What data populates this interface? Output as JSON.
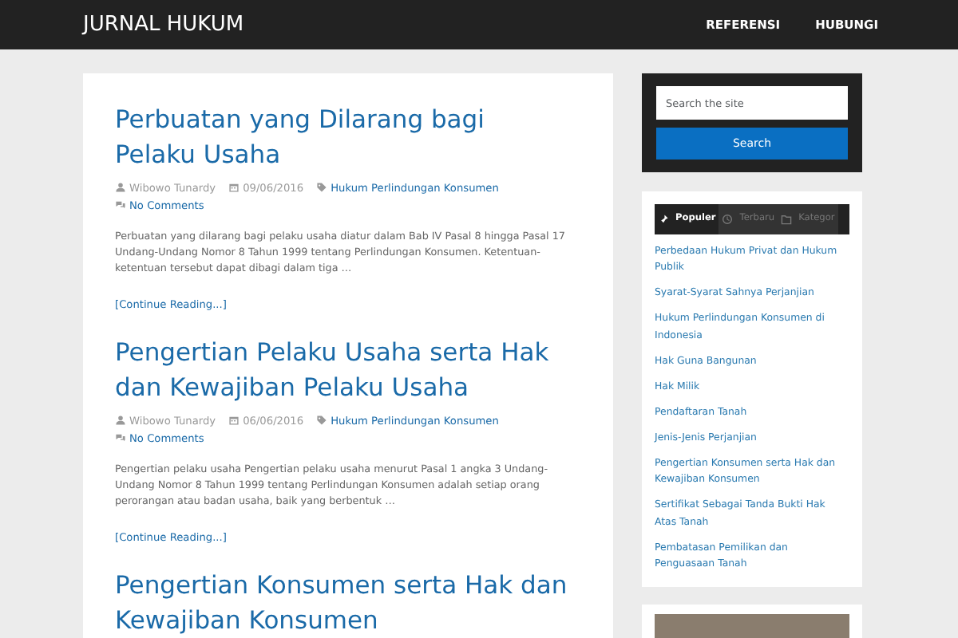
{
  "navbar": {
    "brand": "JURNAL HUKUM",
    "items": [
      "REFERENSI",
      "HUBUNGI"
    ]
  },
  "posts": [
    {
      "title": "Perbuatan yang Dilarang bagi Pelaku Usaha",
      "author": "Wibowo Tunardy",
      "date": "09/06/2016",
      "category": "Hukum Perlindungan Konsumen",
      "comments": "No Comments",
      "excerpt": "Perbuatan yang dilarang bagi pelaku usaha diatur dalam Bab IV Pasal 8 hingga Pasal 17 Undang-Undang Nomor 8 Tahun 1999 tentang Perlindungan Konsumen. Ketentuan-ketentuan tersebut dapat dibagi dalam tiga …",
      "more": "[Continue Reading...]"
    },
    {
      "title": "Pengertian Pelaku Usaha serta Hak dan Kewajiban Pelaku Usaha",
      "author": "Wibowo Tunardy",
      "date": "06/06/2016",
      "category": "Hukum Perlindungan Konsumen",
      "comments": "No Comments",
      "excerpt": "Pengertian pelaku usaha Pengertian pelaku usaha menurut Pasal 1 angka 3 Undang-Undang Nomor 8 Tahun 1999 tentang Perlindungan Konsumen adalah setiap orang perorangan atau badan usaha, baik yang berbentuk …",
      "more": "[Continue Reading...]"
    },
    {
      "title": "Pengertian Konsumen serta Hak dan Kewajiban Konsumen"
    }
  ],
  "search": {
    "placeholder": "Search the site",
    "button": "Search"
  },
  "tabs": [
    {
      "label": "Populer",
      "kind": "popular",
      "selected": true
    },
    {
      "label": "Terbaru",
      "kind": "recent",
      "selected": false
    },
    {
      "label": "Kategor",
      "kind": "category",
      "selected": false
    }
  ],
  "links": [
    "Perbedaan Hukum Privat dan Hukum Publik",
    "Syarat-Syarat Sahnya Perjanjian",
    "Hukum Perlindungan Konsumen di Indonesia",
    "Hak Guna Bangunan",
    "Hak Milik",
    "Pendaftaran Tanah",
    "Jenis-Jenis Perjanjian",
    "Pengertian Konsumen serta Hak dan Kewajiban Konsumen",
    "Sertifikat Sebagai Tanda Bukti Hak Atas Tanah",
    "Pembatasan Pemilikan dan Penguasaan Tanah"
  ]
}
